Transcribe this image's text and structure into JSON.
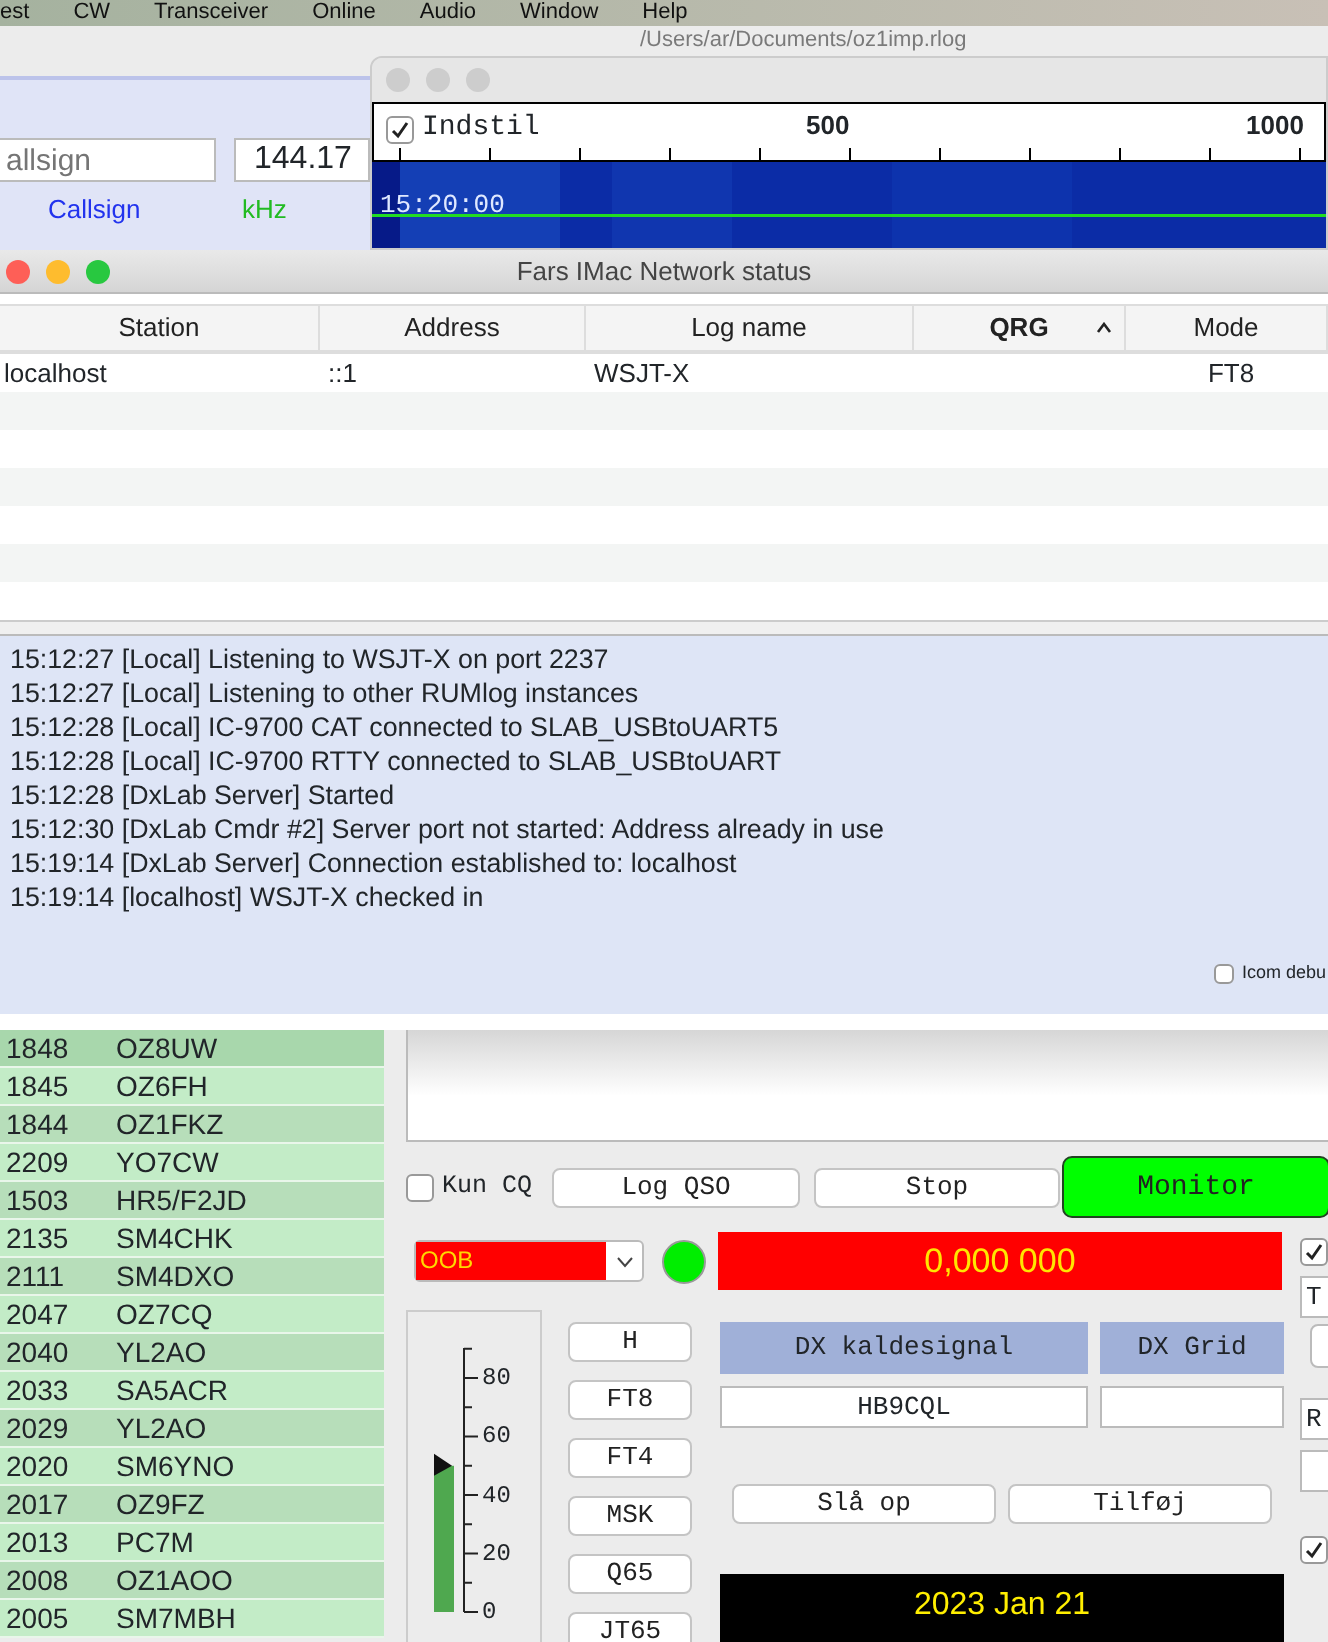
{
  "menu_bar": {
    "items": [
      "est",
      "CW",
      "Transceiver",
      "Online",
      "Audio",
      "Window",
      "Help"
    ]
  },
  "main_window": {
    "title": "/Users/ar/Documents/oz1imp.rlog",
    "callsign_field": {
      "placeholder": "allsign"
    },
    "frequency_field": {
      "value": "144.17"
    },
    "callsign_label": "Callsign",
    "frequency_label": "kHz"
  },
  "waterfall_window": {
    "settings_checkbox": {
      "label": "Indstil",
      "checked": true
    },
    "scale_labels": [
      "500",
      "1000"
    ],
    "time_label": "15:20:00"
  },
  "network_status_window": {
    "title": "Fars IMac Network status",
    "columns": [
      {
        "label": "Station",
        "sorted": false
      },
      {
        "label": "Address",
        "sorted": false
      },
      {
        "label": "Log name",
        "sorted": false
      },
      {
        "label": "QRG",
        "sorted": true
      },
      {
        "label": "Mode",
        "sorted": false
      }
    ],
    "rows": [
      {
        "station": "localhost",
        "address": "::1",
        "log_name": "WSJT-X",
        "mode": "FT8"
      }
    ],
    "log_lines": [
      "15:12:27 [Local] Listening to WSJT-X on port 2237",
      "15:12:27 [Local] Listening to other RUMlog instances",
      "15:12:28 [Local] IC-9700 CAT connected to SLAB_USBtoUART5",
      "15:12:28 [Local] IC-9700 RTTY connected to SLAB_USBtoUART",
      "15:12:28 [DxLab Server] Started",
      "15:12:30 [DxLab Cmdr #2] Server port not started: Address already in use",
      "15:19:14 [DxLab Server] Connection established to: localhost",
      "15:19:14 [localhost] WSJT-X checked in"
    ],
    "debug_checkbox": {
      "label": "Icom debu",
      "checked": false
    }
  },
  "spot_list": [
    {
      "column_1": "1848",
      "column_2": "OZ8UW"
    },
    {
      "column_1": "1845",
      "column_2": "OZ6FH"
    },
    {
      "column_1": "1844",
      "column_2": "OZ1FKZ"
    },
    {
      "column_1": "2209",
      "column_2": "YO7CW"
    },
    {
      "column_1": "1503",
      "column_2": "HR5/F2JD"
    },
    {
      "column_1": "2135",
      "column_2": "SM4CHK"
    },
    {
      "column_1": "2111",
      "column_2": "SM4DXO"
    },
    {
      "column_1": "2047",
      "column_2": "OZ7CQ"
    },
    {
      "column_1": "2040",
      "column_2": "YL2AO"
    },
    {
      "column_1": "2033",
      "column_2": "SA5ACR"
    },
    {
      "column_1": "2029",
      "column_2": "YL2AO"
    },
    {
      "column_1": "2020",
      "column_2": "SM6YNO"
    },
    {
      "column_1": "2017",
      "column_2": "OZ9FZ"
    },
    {
      "column_1": "2013",
      "column_2": "PC7M"
    },
    {
      "column_1": "2008",
      "column_2": "OZ1AOO"
    },
    {
      "column_1": "2005",
      "column_2": "SM7MBH"
    }
  ],
  "wsjt_panel": {
    "cq_only_checkbox": {
      "label": "Kun CQ",
      "checked": false
    },
    "buttons": [
      {
        "label": "Log QSO",
        "active": false
      },
      {
        "label": "Stop",
        "active": false
      },
      {
        "label": "Monitor",
        "active": true
      }
    ],
    "band_select": {
      "value": "OOB"
    },
    "frequency_display": "0,000 000",
    "meter": {
      "level": 0.5,
      "scale": [
        "80",
        "60",
        "40",
        "20",
        "0"
      ]
    },
    "mode_buttons": [
      "H",
      "FT8",
      "FT4",
      "MSK",
      "Q65",
      "JT65"
    ],
    "dx_call_label": "DX kaldesignal",
    "dx_grid_label": "DX Grid",
    "dx_call_field": {
      "value": "HB9CQL"
    },
    "lookup_button": "Slå op",
    "add_button": "Tilføj",
    "date_display": "2023 Jan 21",
    "side_controls": [
      {
        "kind": "checkbox",
        "checked": true
      },
      {
        "kind": "field",
        "text": "T"
      },
      {
        "kind": "button"
      },
      {
        "kind": "field",
        "text": "R"
      },
      {
        "kind": "field"
      },
      {
        "kind": "checkbox",
        "checked": true
      }
    ]
  }
}
